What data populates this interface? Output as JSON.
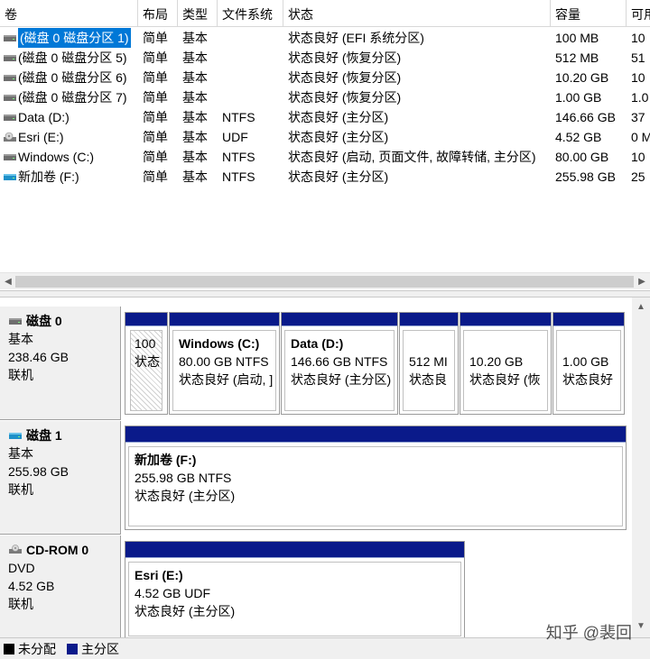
{
  "columns": [
    "卷",
    "布局",
    "类型",
    "文件系统",
    "状态",
    "容量",
    "可用"
  ],
  "volumes": [
    {
      "name": "(磁盘 0 磁盘分区 1)",
      "layout": "简单",
      "type": "基本",
      "fs": "",
      "status": "状态良好 (EFI 系统分区)",
      "capacity": "100 MB",
      "free": "10",
      "selected": true
    },
    {
      "name": "(磁盘 0 磁盘分区 5)",
      "layout": "简单",
      "type": "基本",
      "fs": "",
      "status": "状态良好 (恢复分区)",
      "capacity": "512 MB",
      "free": "51"
    },
    {
      "name": "(磁盘 0 磁盘分区 6)",
      "layout": "简单",
      "type": "基本",
      "fs": "",
      "status": "状态良好 (恢复分区)",
      "capacity": "10.20 GB",
      "free": "10"
    },
    {
      "name": "(磁盘 0 磁盘分区 7)",
      "layout": "简单",
      "type": "基本",
      "fs": "",
      "status": "状态良好 (恢复分区)",
      "capacity": "1.00 GB",
      "free": "1.0"
    },
    {
      "name": "Data (D:)",
      "layout": "简单",
      "type": "基本",
      "fs": "NTFS",
      "status": "状态良好 (主分区)",
      "capacity": "146.66 GB",
      "free": "37"
    },
    {
      "name": "Esri (E:)",
      "layout": "简单",
      "type": "基本",
      "fs": "UDF",
      "status": "状态良好 (主分区)",
      "capacity": "4.52 GB",
      "free": "0 M"
    },
    {
      "name": "Windows (C:)",
      "layout": "简单",
      "type": "基本",
      "fs": "NTFS",
      "status": "状态良好 (启动, 页面文件, 故障转储, 主分区)",
      "capacity": "80.00 GB",
      "free": "10"
    },
    {
      "name": "新加卷 (F:)",
      "layout": "简单",
      "type": "基本",
      "fs": "NTFS",
      "status": "状态良好 (主分区)",
      "capacity": "255.98 GB",
      "free": "25"
    }
  ],
  "volume_icons": [
    "drive-icon",
    "drive-icon",
    "drive-icon",
    "drive-icon",
    "drive-icon",
    "cd-icon",
    "drive-icon",
    "usb-drive-icon"
  ],
  "disks": [
    {
      "title": "磁盘 0",
      "kind": "基本",
      "size": "238.46 GB",
      "state": "联机",
      "partitions": [
        {
          "name": "",
          "line1": "100",
          "line2": "状态"
        },
        {
          "name": "Windows  (C:)",
          "line1": "80.00 GB NTFS",
          "line2": "状态良好 (启动, ]"
        },
        {
          "name": "Data  (D:)",
          "line1": "146.66 GB NTFS",
          "line2": "状态良好 (主分区)"
        },
        {
          "name": "",
          "line1": "512 MI",
          "line2": "状态良"
        },
        {
          "name": "",
          "line1": "10.20 GB",
          "line2": "状态良好 (恢"
        },
        {
          "name": "",
          "line1": "1.00 GB",
          "line2": "状态良好"
        }
      ]
    },
    {
      "title": "磁盘 1",
      "kind": "基本",
      "size": "255.98 GB",
      "state": "联机",
      "partitions": [
        {
          "name": "新加卷  (F:)",
          "line1": "255.98 GB NTFS",
          "line2": "状态良好 (主分区)"
        }
      ]
    },
    {
      "title": "CD-ROM 0",
      "kind": "DVD",
      "size": "4.52 GB",
      "state": "联机",
      "partitions": [
        {
          "name": "Esri  (E:)",
          "line1": "4.52 GB UDF",
          "line2": "状态良好 (主分区)"
        }
      ]
    }
  ],
  "legend": {
    "unallocated": "未分配",
    "primary": "主分区"
  },
  "colors": {
    "unallocated": "#000000",
    "primary": "#0a1a8a",
    "selection": "#0078d7"
  },
  "watermark": "知乎 @裴回"
}
